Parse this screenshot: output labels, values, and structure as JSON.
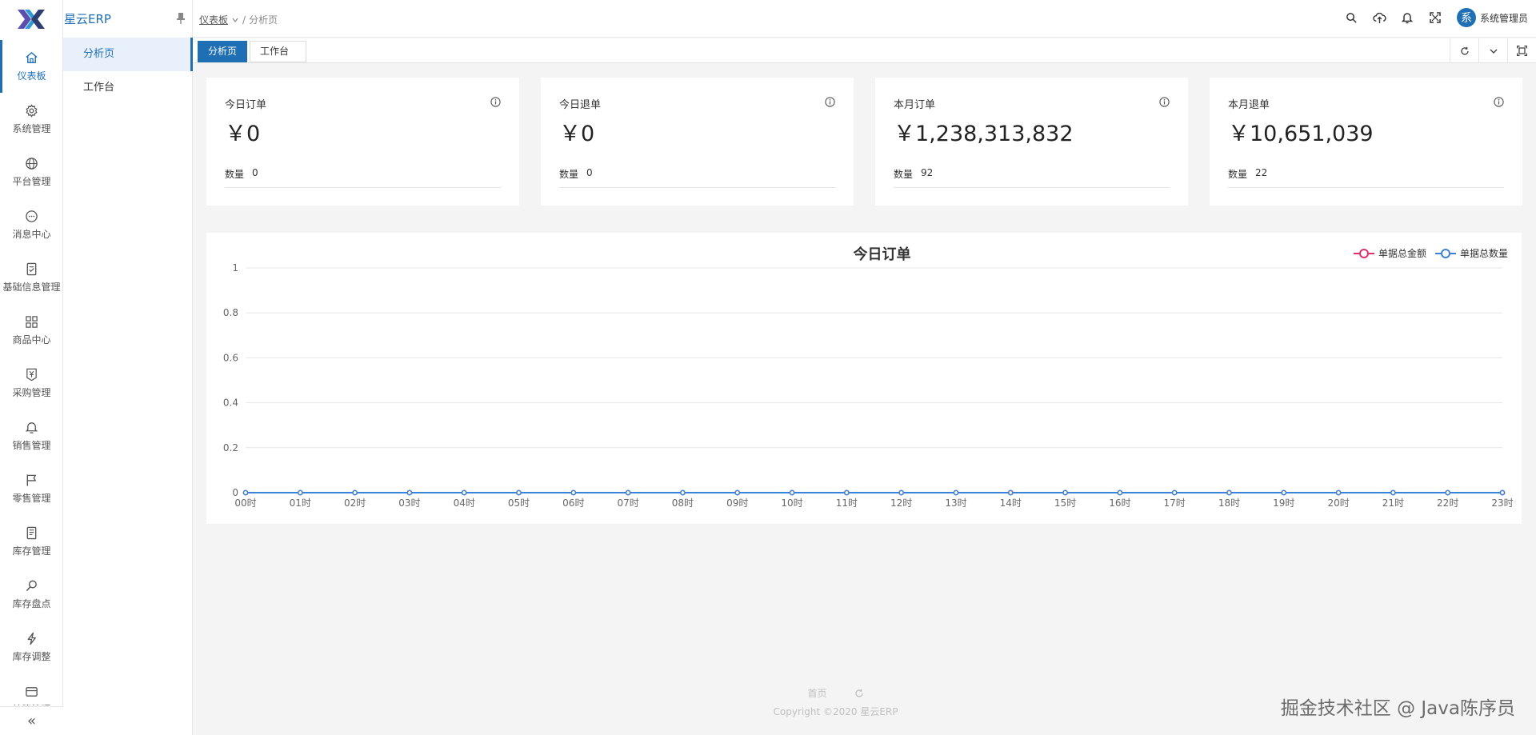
{
  "app": {
    "title": "星云ERP"
  },
  "rail": {
    "items": [
      {
        "label": "仪表板",
        "icon": "home-icon",
        "active": true
      },
      {
        "label": "系统管理",
        "icon": "gear-icon"
      },
      {
        "label": "平台管理",
        "icon": "globe-icon"
      },
      {
        "label": "消息中心",
        "icon": "message-icon"
      },
      {
        "label": "基础信息管理",
        "icon": "document-icon"
      },
      {
        "label": "商品中心",
        "icon": "grid-icon"
      },
      {
        "label": "采购管理",
        "icon": "yen-tag-icon"
      },
      {
        "label": "销售管理",
        "icon": "bell-icon"
      },
      {
        "label": "零售管理",
        "icon": "flag-icon"
      },
      {
        "label": "库存管理",
        "icon": "book-icon"
      },
      {
        "label": "库存盘点",
        "icon": "search-icon"
      },
      {
        "label": "库存调整",
        "icon": "lightning-icon"
      },
      {
        "label": "结算管理",
        "icon": "wallet-icon"
      }
    ],
    "collapse_icon": "double-chevron-left-icon"
  },
  "submenu": {
    "items": [
      {
        "label": "分析页",
        "active": true
      },
      {
        "label": "工作台"
      }
    ]
  },
  "header": {
    "breadcrumb": [
      "仪表板",
      "分析页"
    ],
    "user": {
      "name": "系统管理员",
      "avatar_char": "系"
    },
    "tools": [
      "search-icon",
      "cloud-upload-icon",
      "bell-icon",
      "fullscreen-icon"
    ]
  },
  "tabs": [
    {
      "label": "分析页",
      "active": true
    },
    {
      "label": "工作台"
    }
  ],
  "cards": [
    {
      "title": "今日订单",
      "value": "￥0",
      "count_label": "数量",
      "count": "0"
    },
    {
      "title": "今日退单",
      "value": "￥0",
      "count_label": "数量",
      "count": "0"
    },
    {
      "title": "本月订单",
      "value": "￥1,238,313,832",
      "count_label": "数量",
      "count": "92"
    },
    {
      "title": "本月退单",
      "value": "￥10,651,039",
      "count_label": "数量",
      "count": "22"
    }
  ],
  "chart_data": {
    "type": "line",
    "title": "今日订单",
    "categories": [
      "00时",
      "01时",
      "02时",
      "03时",
      "04时",
      "05时",
      "06时",
      "07时",
      "08时",
      "09时",
      "10时",
      "11时",
      "12时",
      "13时",
      "14时",
      "15时",
      "16时",
      "17时",
      "18时",
      "19时",
      "20时",
      "21时",
      "22时",
      "23时"
    ],
    "series": [
      {
        "name": "单据总金额",
        "color": "#e0306b",
        "values": [
          0,
          0,
          0,
          0,
          0,
          0,
          0,
          0,
          0,
          0,
          0,
          0,
          0,
          0,
          0,
          0,
          0,
          0,
          0,
          0,
          0,
          0,
          0,
          0
        ]
      },
      {
        "name": "单据总数量",
        "color": "#3b82d6",
        "values": [
          0,
          0,
          0,
          0,
          0,
          0,
          0,
          0,
          0,
          0,
          0,
          0,
          0,
          0,
          0,
          0,
          0,
          0,
          0,
          0,
          0,
          0,
          0,
          0
        ]
      }
    ],
    "yticks": [
      "0",
      "0.2",
      "0.4",
      "0.6",
      "0.8",
      "1"
    ],
    "ylim": [
      0,
      1
    ],
    "legend_position": "top-right",
    "grid": true
  },
  "footer": {
    "links": [
      "首页"
    ],
    "refresh_icon": "refresh-icon",
    "copyright": "Copyright ©2020 星云ERP"
  },
  "watermark": "掘金技术社区 @ Java陈序员"
}
